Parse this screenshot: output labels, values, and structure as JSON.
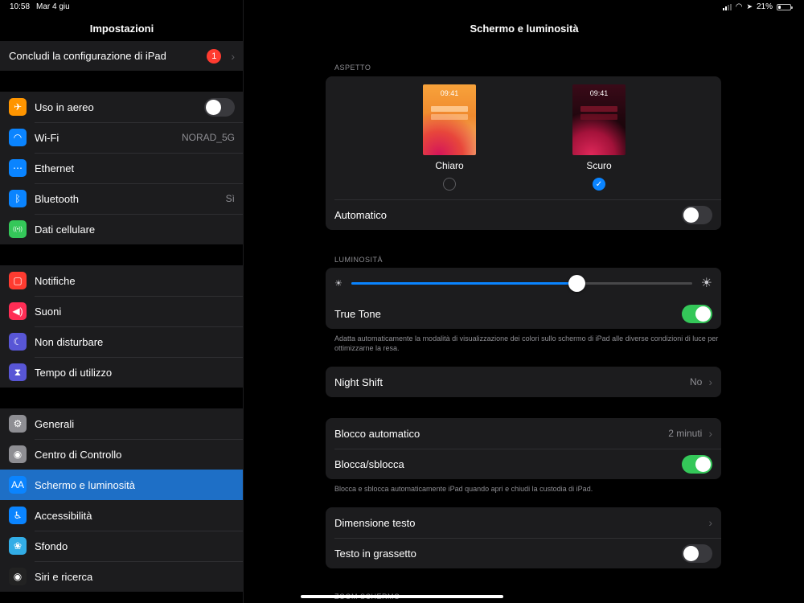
{
  "status_bar": {
    "time": "10:58",
    "date": "Mar 4 giu",
    "battery": "21%",
    "battery_level": 0.21
  },
  "sidebar": {
    "title": "Impostazioni",
    "setup": {
      "label": "Concludi la configurazione di iPad",
      "badge": "1"
    },
    "groups": [
      [
        {
          "label": "Uso in aereo",
          "icon": "airplane-icon",
          "color": "#ff9500",
          "glyph": "✈",
          "toggle": false
        },
        {
          "label": "Wi-Fi",
          "icon": "wifi-icon",
          "color": "#0a84ff",
          "glyph": "◠",
          "value": "NORAD_5G"
        },
        {
          "label": "Ethernet",
          "icon": "ethernet-icon",
          "color": "#0a84ff",
          "glyph": "⋯"
        },
        {
          "label": "Bluetooth",
          "icon": "bluetooth-icon",
          "color": "#0a84ff",
          "glyph": "ᛒ",
          "value": "Sì"
        },
        {
          "label": "Dati cellulare",
          "icon": "cellular-icon",
          "color": "#34c759",
          "glyph": "((•))"
        }
      ],
      [
        {
          "label": "Notifiche",
          "icon": "notifications-icon",
          "color": "#ff3b30",
          "glyph": "▢"
        },
        {
          "label": "Suoni",
          "icon": "sounds-icon",
          "color": "#ff2d55",
          "glyph": "◀)"
        },
        {
          "label": "Non disturbare",
          "icon": "moon-icon",
          "color": "#5856d6",
          "glyph": "☾"
        },
        {
          "label": "Tempo di utilizzo",
          "icon": "hourglass-icon",
          "color": "#5856d6",
          "glyph": "⧗"
        }
      ],
      [
        {
          "label": "Generali",
          "icon": "gear-icon",
          "color": "#8e8e93",
          "glyph": "⚙"
        },
        {
          "label": "Centro di Controllo",
          "icon": "control-center-icon",
          "color": "#8e8e93",
          "glyph": "◉"
        },
        {
          "label": "Schermo e luminosità",
          "icon": "display-icon",
          "color": "#0a84ff",
          "glyph": "AA",
          "selected": true
        },
        {
          "label": "Accessibilità",
          "icon": "accessibility-icon",
          "color": "#0a84ff",
          "glyph": "♿"
        },
        {
          "label": "Sfondo",
          "icon": "wallpaper-icon",
          "color": "#32ade6",
          "glyph": "❀"
        },
        {
          "label": "Siri e ricerca",
          "icon": "siri-icon",
          "color": "#222",
          "glyph": "◉"
        }
      ]
    ]
  },
  "detail": {
    "title": "Schermo e luminosità",
    "appearance_header": "ASPETTO",
    "light_label": "Chiaro",
    "dark_label": "Scuro",
    "preview_time": "09:41",
    "automatic_label": "Automatico",
    "brightness_header": "LUMINOSITÀ",
    "brightness_level": 0.66,
    "true_tone_label": "True Tone",
    "true_tone_note": "Adatta automaticamente la modalità di visualizzazione dei colori sullo schermo di iPad alle diverse condizioni di luce per ottimizzarne la resa.",
    "night_shift_label": "Night Shift",
    "night_shift_value": "No",
    "auto_lock_label": "Blocco automatico",
    "auto_lock_value": "2 minuti",
    "lock_unlock_label": "Blocca/sblocca",
    "lock_unlock_note": "Blocca e sblocca automaticamente iPad quando apri e chiudi la custodia di iPad.",
    "text_size_label": "Dimensione testo",
    "bold_text_label": "Testo in grassetto",
    "zoom_header": "ZOOM SCHERMO"
  }
}
